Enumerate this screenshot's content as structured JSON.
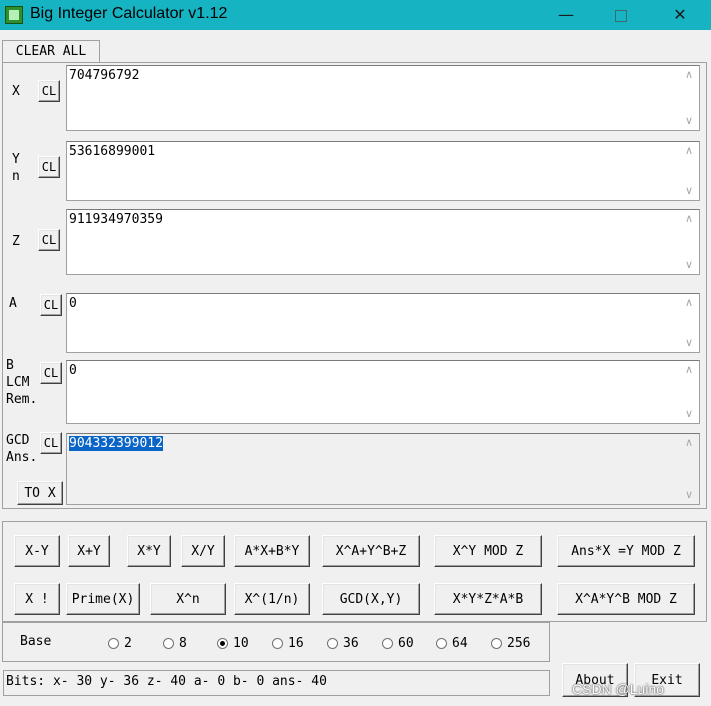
{
  "window": {
    "title": "Big Integer Calculator v1.12",
    "minimize_glyph": "—",
    "close_glyph": "✕"
  },
  "clear_all_label": "CLEAR ALL",
  "cl_label": "CL",
  "fields": {
    "x": {
      "label": "X",
      "value": "704796792"
    },
    "y": {
      "label": "Y\nn",
      "value": "53616899001"
    },
    "z": {
      "label": "Z",
      "value": "911934970359"
    },
    "a": {
      "label": "A",
      "value": "0"
    },
    "b": {
      "label": "B\nLCM\nRem.",
      "value": "0"
    },
    "ans": {
      "label": "GCD\nAns.",
      "value": "904332399012",
      "selected": true
    }
  },
  "to_x_label": "TO X",
  "scroll_up_glyph": "∧",
  "scroll_down_glyph": "∨",
  "ops": {
    "x_minus_y": "X-Y",
    "x_plus_y": "X+Y",
    "x_times_y": "X*Y",
    "x_div_y": "X/Y",
    "axby": "A*X+B*Y",
    "xaybz": "X^A+Y^B+Z",
    "xy_mod_z": "X^Y MOD Z",
    "ansx_mod": "Ans*X =Y MOD Z",
    "x_fact": "X !",
    "prime_x": "Prime(X)",
    "x_pow_n": "X^n",
    "x_root_n": "X^(1/n)",
    "gcd": "GCD(X,Y)",
    "xyzab": "X*Y*Z*A*B",
    "xayb_mod": "X^A*Y^B MOD Z"
  },
  "base": {
    "label": "Base",
    "options": [
      "2",
      "8",
      "10",
      "16",
      "36",
      "60",
      "64",
      "256"
    ],
    "selected": "10"
  },
  "status_text": "Bits: x- 30 y- 36 z- 40 a- 0 b- 0 ans- 40",
  "about_label": "About",
  "exit_label": "Exit",
  "watermark": "CSDN @Luino"
}
